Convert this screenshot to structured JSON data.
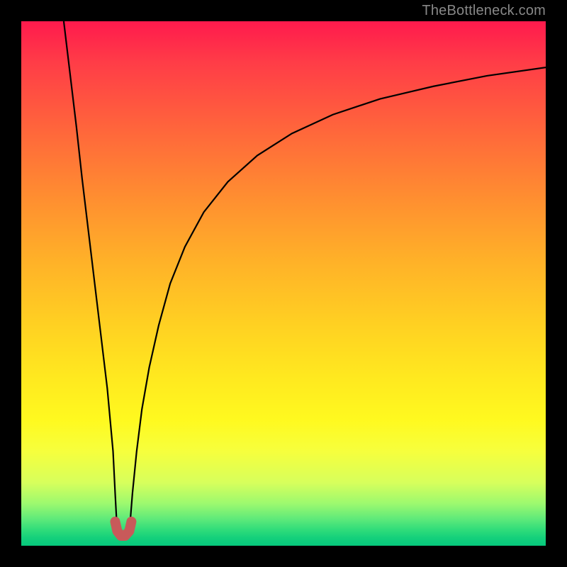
{
  "watermark": "TheBottleneck.com",
  "chart_data": {
    "type": "line",
    "title": "",
    "xlabel": "",
    "ylabel": "",
    "xlim": [
      0,
      100
    ],
    "ylim": [
      0,
      100
    ],
    "grid": false,
    "legend": false,
    "series": [
      {
        "name": "left-branch",
        "x": [
          8.1,
          9.3,
          10.5,
          11.6,
          12.8,
          14.0,
          15.2,
          16.4,
          17.5,
          17.9,
          18.3
        ],
        "y": [
          100,
          90,
          80,
          70,
          60,
          50,
          40,
          30,
          18,
          10,
          2.5
        ]
      },
      {
        "name": "right-branch",
        "x": [
          20.6,
          21.2,
          22.0,
          23.0,
          24.4,
          26.2,
          28.4,
          31.2,
          34.8,
          39.4,
          45.0,
          51.6,
          59.4,
          68.4,
          78.6,
          88.8,
          100
        ],
        "y": [
          2.5,
          10,
          18,
          26,
          34,
          42,
          50,
          57,
          63.6,
          69.4,
          74.4,
          78.6,
          82.2,
          85.2,
          87.6,
          89.6,
          91.2
        ]
      },
      {
        "name": "marker-u",
        "x": [
          17.9,
          18.3,
          19.0,
          19.8,
          20.6,
          21.0
        ],
        "y": [
          4.6,
          2.8,
          1.9,
          1.9,
          2.8,
          4.6
        ]
      }
    ],
    "gradient_stops": [
      {
        "pos": 0,
        "color": "#ff1a4d"
      },
      {
        "pos": 50,
        "color": "#ffc524"
      },
      {
        "pos": 80,
        "color": "#fff91f"
      },
      {
        "pos": 100,
        "color": "#06c87c"
      }
    ]
  }
}
